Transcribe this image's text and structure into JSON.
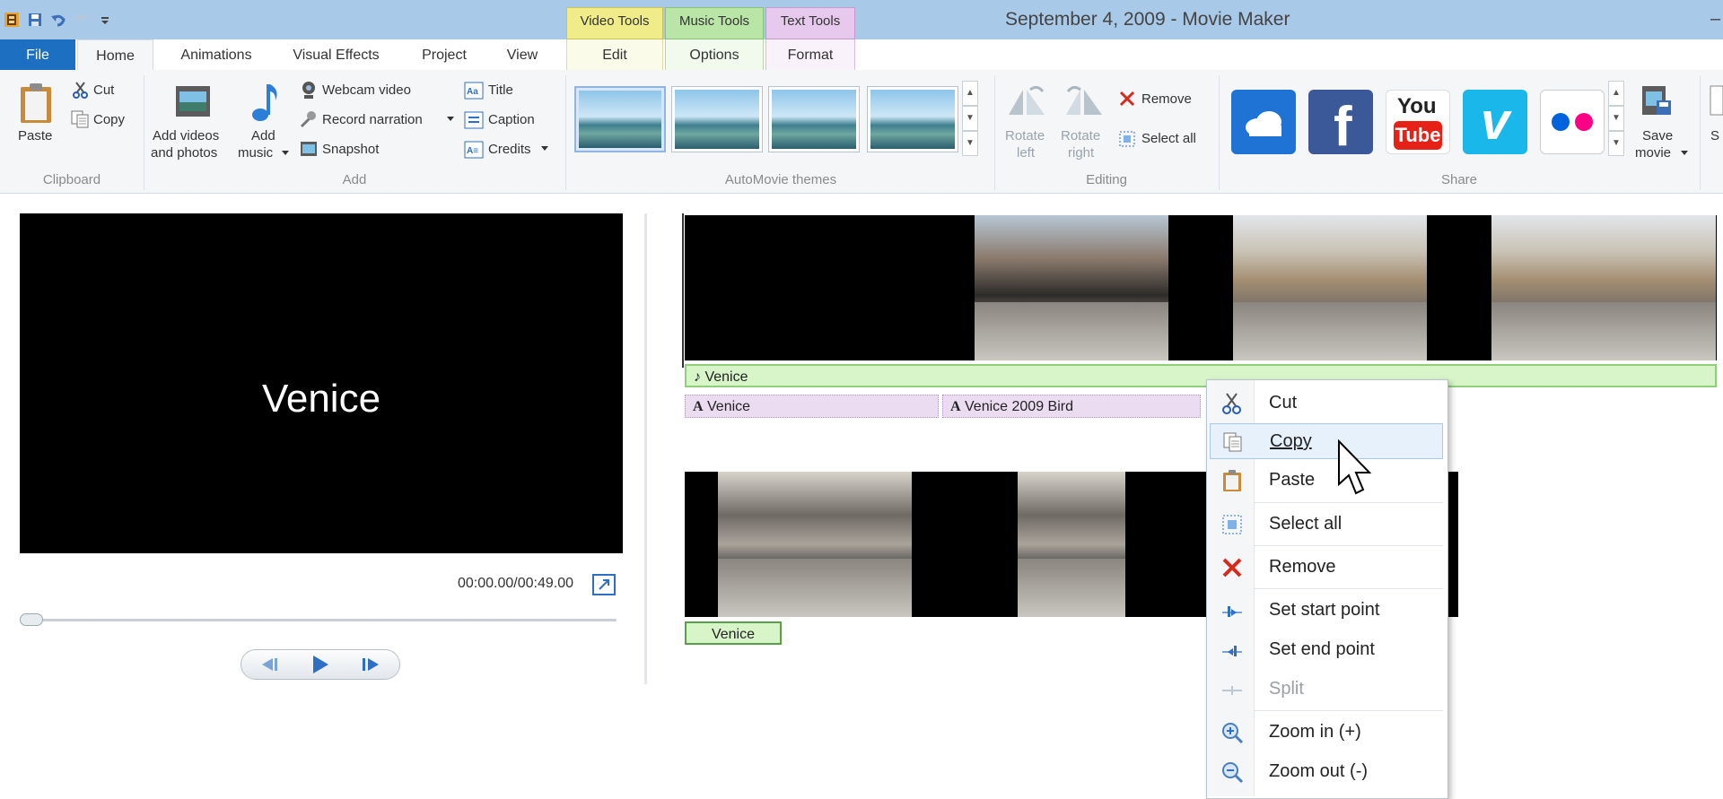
{
  "window": {
    "title": "September 4, 2009 - Movie Maker",
    "minimize_glyph": "–"
  },
  "context_tabs": {
    "video_tools": "Video Tools",
    "music_tools": "Music Tools",
    "text_tools": "Text Tools"
  },
  "tabs": [
    "File",
    "Home",
    "Animations",
    "Visual Effects",
    "Project",
    "View",
    "Edit",
    "Options",
    "Format"
  ],
  "ribbon": {
    "clipboard": {
      "paste": "Paste",
      "cut": "Cut",
      "copy": "Copy",
      "group": "Clipboard"
    },
    "add": {
      "add_videos_l1": "Add videos",
      "add_videos_l2": "and photos",
      "add_music_l1": "Add",
      "add_music_l2": "music",
      "webcam": "Webcam video",
      "narration": "Record narration",
      "snapshot": "Snapshot",
      "title": "Title",
      "caption": "Caption",
      "credits": "Credits",
      "group": "Add"
    },
    "themes": {
      "group": "AutoMovie themes"
    },
    "editing": {
      "rotate_left_l1": "Rotate",
      "rotate_left_l2": "left",
      "rotate_right_l1": "Rotate",
      "rotate_right_l2": "right",
      "remove": "Remove",
      "select_all": "Select all",
      "group": "Editing"
    },
    "share": {
      "group": "Share",
      "save_movie_l1": "Save",
      "save_movie_l2": "movie",
      "partial": "S",
      "services": [
        "onedrive-icon",
        "facebook-icon",
        "youtube-icon",
        "vimeo-icon",
        "flickr-icon"
      ],
      "youtube_l1": "You",
      "youtube_l2": "Tube",
      "facebook_glyph": "f",
      "vimeo_glyph": "v"
    }
  },
  "preview": {
    "text": "Venice",
    "timecode": "00:00.00/00:49.00"
  },
  "storyboard": {
    "music_caption": "♪ Venice",
    "text_caption_1": "Venice",
    "text_caption_2": "Venice 2009 Bird",
    "text_glyph": "A",
    "clip_caption": "Venice"
  },
  "context_menu": {
    "items": [
      "Cut",
      "Copy",
      "Paste",
      "Select all",
      "Remove",
      "Set start point",
      "Set end point",
      "Split",
      "Zoom in (+)",
      "Zoom out (-)"
    ]
  },
  "colors": {
    "file_tab": "#1d6fc2",
    "titlebar": "#a9c9e8",
    "video_tools": "#f0ec8a",
    "music_tools": "#b9e6a7",
    "text_tools": "#e7c9ee"
  }
}
